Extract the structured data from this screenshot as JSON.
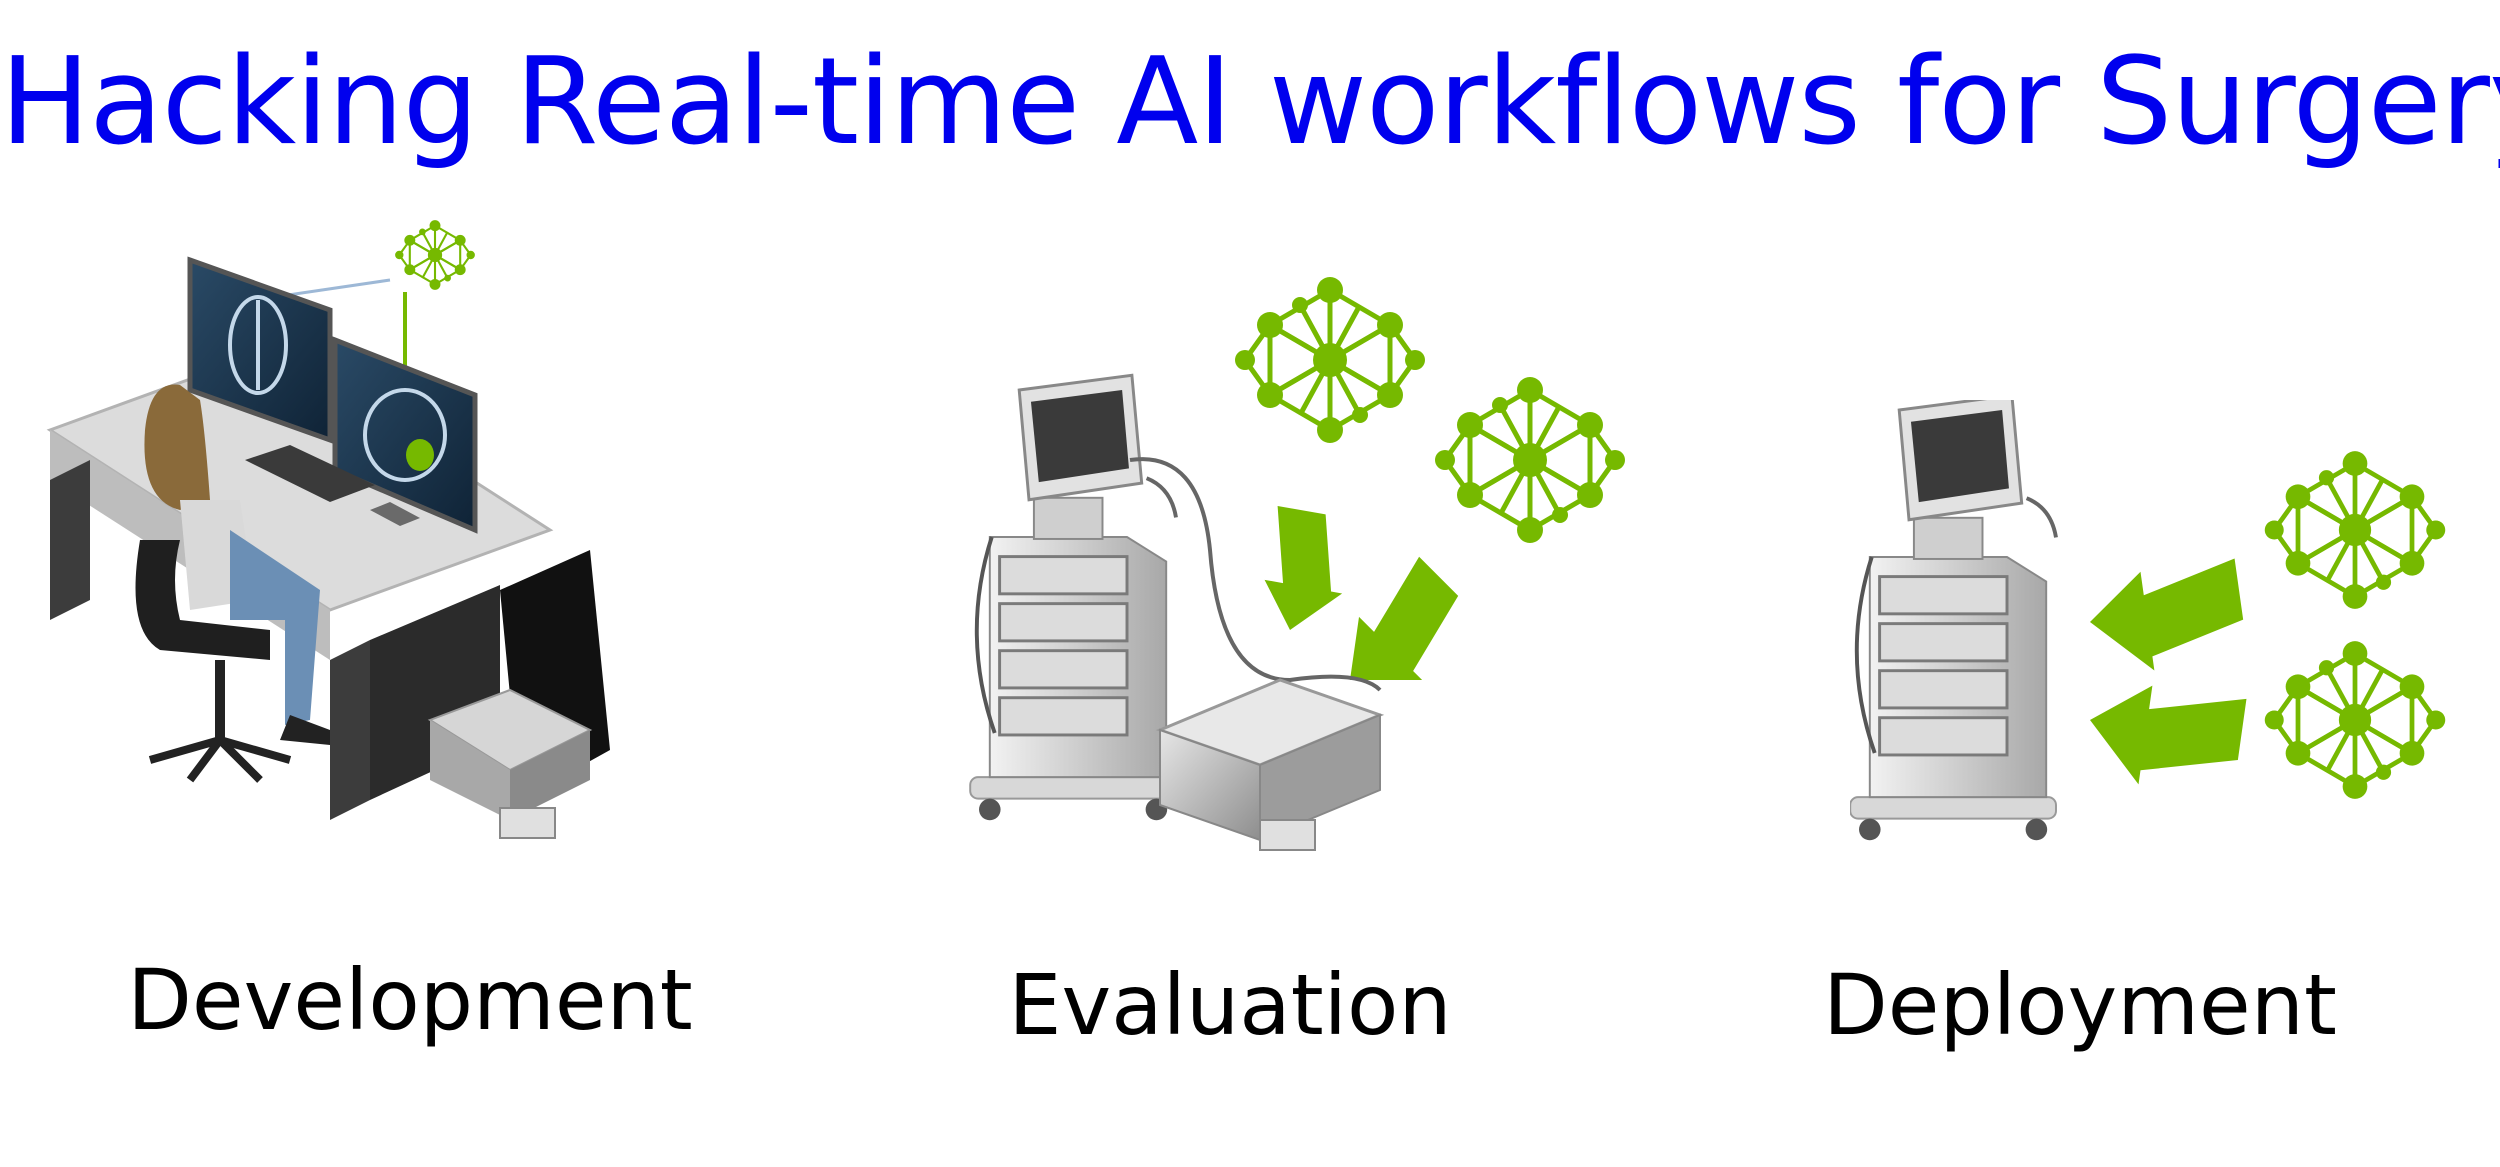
{
  "title": "Hacking Real-time AI workflows for Surgery",
  "stages": [
    {
      "label": "Development"
    },
    {
      "label": "Evaluation"
    },
    {
      "label": "Deployment"
    }
  ],
  "icons": {
    "network": "neural-network-icon",
    "arrow": "arrow-icon",
    "workstation": "developer-workstation-icon",
    "cart": "medical-cart-icon",
    "server": "compute-box-icon"
  },
  "colors": {
    "title": "#0000ee",
    "text": "#000000",
    "green": "#76b900",
    "gray": "#9a9a9a"
  }
}
